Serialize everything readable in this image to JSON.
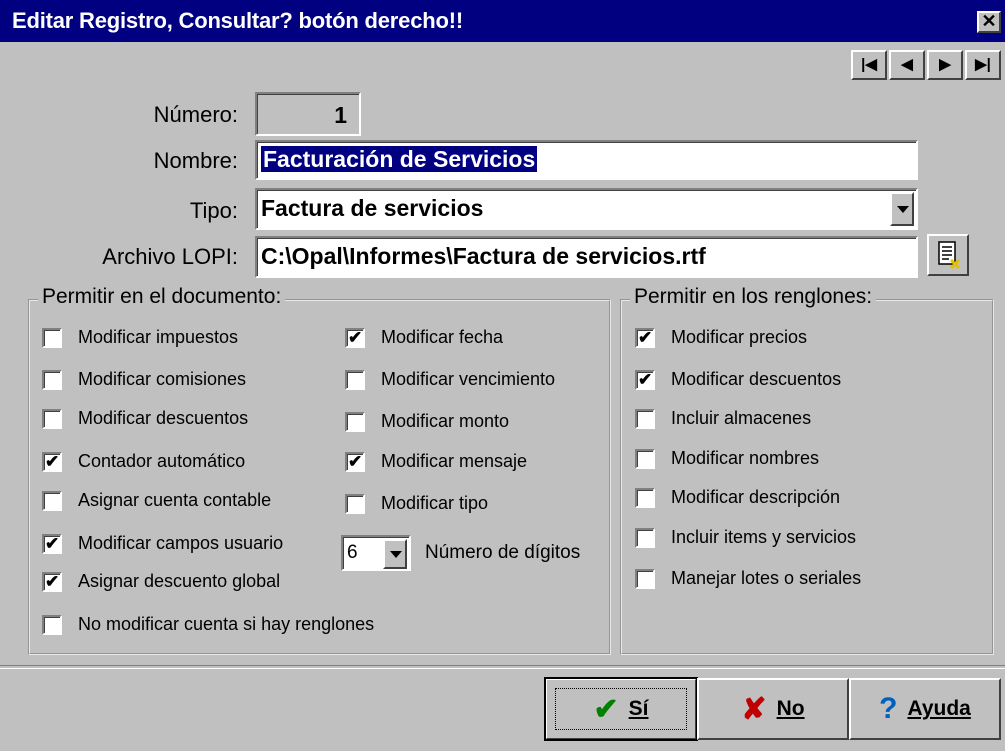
{
  "window": {
    "title": "Editar Registro, Consultar? botón derecho!!",
    "close_glyph": "✕"
  },
  "nav": {
    "first": "|◀",
    "prev": "◀",
    "next": "▶",
    "last": "▶|"
  },
  "fields": {
    "numero_label": "Número:",
    "numero_value": "1",
    "nombre_label": "Nombre:",
    "nombre_value": "Facturación de Servicios",
    "tipo_label": "Tipo:",
    "tipo_value": "Factura de servicios",
    "archivo_label": "Archivo LOPI:",
    "archivo_value": "C:\\Opal\\Informes\\Factura de servicios.rtf"
  },
  "doc_group": {
    "legend": "Permitir en el documento:",
    "left": [
      {
        "label": "Modificar impuestos",
        "checked": false
      },
      {
        "label": "Modificar comisiones",
        "checked": false
      },
      {
        "label": "Modificar descuentos",
        "checked": false
      },
      {
        "label": "Contador automático",
        "checked": true
      },
      {
        "label": "Asignar cuenta contable",
        "checked": false
      },
      {
        "label": "Modificar campos usuario",
        "checked": true
      },
      {
        "label": "Asignar descuento global",
        "checked": true
      },
      {
        "label": "No modificar cuenta si hay renglones",
        "checked": false
      }
    ],
    "right": [
      {
        "label": "Modificar fecha",
        "checked": true
      },
      {
        "label": "Modificar vencimiento",
        "checked": false
      },
      {
        "label": "Modificar monto",
        "checked": false
      },
      {
        "label": "Modificar mensaje",
        "checked": true
      },
      {
        "label": "Modificar tipo",
        "checked": false
      }
    ],
    "digits_value": "6",
    "digits_label": "Número de dígitos"
  },
  "row_group": {
    "legend": "Permitir en los renglones:",
    "items": [
      {
        "label": "Modificar precios",
        "checked": true
      },
      {
        "label": "Modificar descuentos",
        "checked": true
      },
      {
        "label": "Incluir almacenes",
        "checked": false
      },
      {
        "label": "Modificar nombres",
        "checked": false
      },
      {
        "label": "Modificar descripción",
        "checked": false
      },
      {
        "label": "Incluir items y servicios",
        "checked": false
      },
      {
        "label": "Manejar lotes o seriales",
        "checked": false
      }
    ]
  },
  "buttons": {
    "si": "Sí",
    "no": "No",
    "ayuda": "Ayuda"
  },
  "colors": {
    "titlebar": "#000080",
    "face": "#c0c0c0",
    "check_green": "#008000",
    "x_red": "#c00000",
    "help_blue": "#0060c0"
  }
}
